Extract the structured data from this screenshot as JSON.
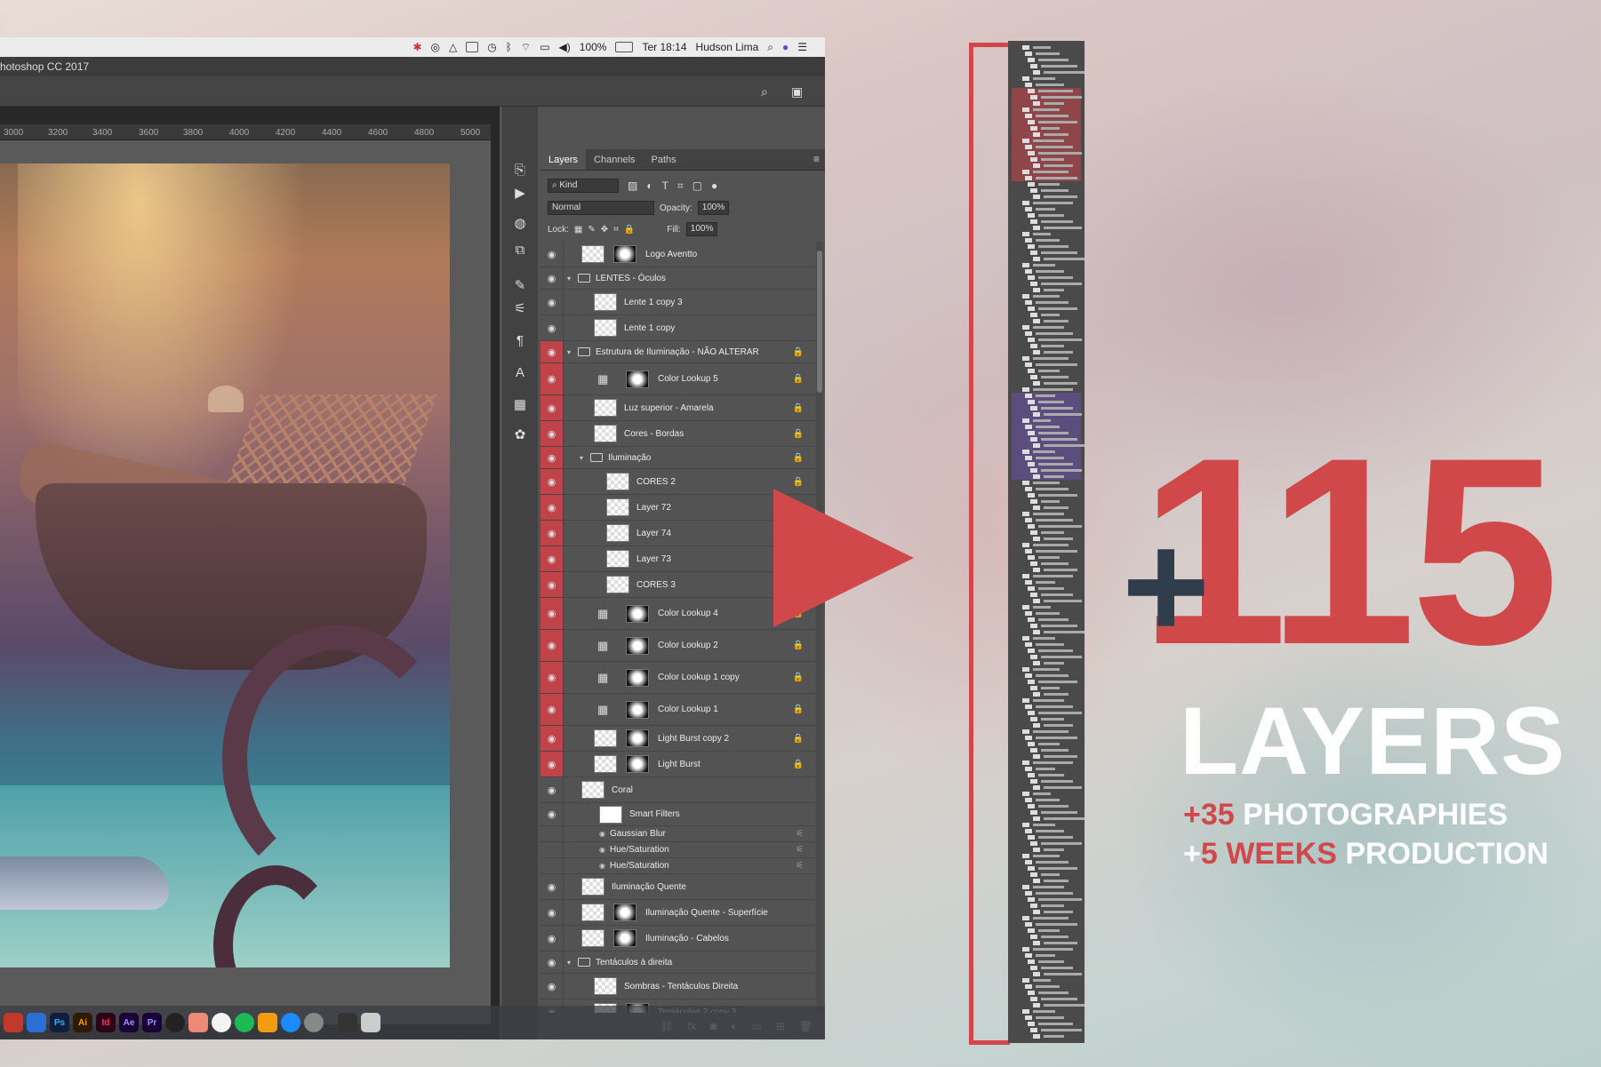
{
  "menubar": {
    "battery": "100%",
    "time": "Ter 18:14",
    "user": "Hudson Lima"
  },
  "app": {
    "title": "hotoshop CC 2017"
  },
  "ruler": {
    "ticks": [
      "3000",
      "3200",
      "3400",
      "3600",
      "3800",
      "4000",
      "4200",
      "4400",
      "4600",
      "4800",
      "5000"
    ]
  },
  "panel": {
    "tabs": [
      "Layers",
      "Channels",
      "Paths"
    ],
    "filter_kind": "Kind",
    "blend_mode": "Normal",
    "opacity_label": "Opacity:",
    "opacity_value": "100%",
    "lock_label": "Lock:",
    "fill_label": "Fill:",
    "fill_value": "100%"
  },
  "layers": [
    {
      "name": "Logo Aventto",
      "type": "thumbmask",
      "red": false,
      "indent": 0,
      "lock": false
    },
    {
      "name": "LENTES - Óculos",
      "type": "group",
      "red": false,
      "indent": 0,
      "lock": false
    },
    {
      "name": "Lente 1 copy 3",
      "type": "thumb",
      "red": false,
      "indent": 1,
      "lock": false
    },
    {
      "name": "Lente 1 copy",
      "type": "thumb",
      "red": false,
      "indent": 1,
      "lock": false
    },
    {
      "name": "Estrutura de Iluminação - NÃO ALTERAR",
      "type": "group",
      "red": true,
      "indent": 0,
      "lock": true
    },
    {
      "name": "Color Lookup 5",
      "type": "adjmask",
      "red": true,
      "indent": 1,
      "lock": true
    },
    {
      "name": "Luz superior - Amarela",
      "type": "thumb",
      "red": true,
      "indent": 1,
      "lock": true
    },
    {
      "name": "Cores - Bordas",
      "type": "thumb",
      "red": true,
      "indent": 1,
      "lock": true
    },
    {
      "name": "Iluminação",
      "type": "group",
      "red": true,
      "indent": 1,
      "lock": true
    },
    {
      "name": "CORES 2",
      "type": "thumb",
      "red": true,
      "indent": 2,
      "lock": true
    },
    {
      "name": "Layer 72",
      "type": "thumb",
      "red": true,
      "indent": 2,
      "lock": true
    },
    {
      "name": "Layer 74",
      "type": "thumb",
      "red": true,
      "indent": 2,
      "lock": true
    },
    {
      "name": "Layer 73",
      "type": "thumb",
      "red": true,
      "indent": 2,
      "lock": true
    },
    {
      "name": "CORES 3",
      "type": "thumb",
      "red": true,
      "indent": 2,
      "lock": true
    },
    {
      "name": "Color Lookup 4",
      "type": "adjmask",
      "red": true,
      "indent": 1,
      "lock": true
    },
    {
      "name": "Color Lookup 2",
      "type": "adjmask",
      "red": true,
      "indent": 1,
      "lock": true
    },
    {
      "name": "Color Lookup 1 copy",
      "type": "adjmask",
      "red": true,
      "indent": 1,
      "lock": true
    },
    {
      "name": "Color Lookup 1",
      "type": "adjmask",
      "red": true,
      "indent": 1,
      "lock": true
    },
    {
      "name": "Light Burst copy 2",
      "type": "thumbmask",
      "red": true,
      "indent": 1,
      "lock": true
    },
    {
      "name": "Light Burst",
      "type": "thumbmask",
      "red": true,
      "indent": 1,
      "lock": true
    },
    {
      "name": "Coral",
      "type": "thumb",
      "red": false,
      "indent": 0,
      "lock": false
    },
    {
      "name": "Smart Filters",
      "type": "smart",
      "red": false,
      "indent": 1,
      "lock": false
    },
    {
      "name": "Gaussian Blur",
      "type": "filter",
      "red": false,
      "indent": 2,
      "lock": false
    },
    {
      "name": "Hue/Saturation",
      "type": "filter",
      "red": false,
      "indent": 2,
      "lock": false
    },
    {
      "name": "Hue/Saturation",
      "type": "filter",
      "red": false,
      "indent": 2,
      "lock": false
    },
    {
      "name": "Iluminação Quente",
      "type": "thumb",
      "red": false,
      "indent": 0,
      "lock": false
    },
    {
      "name": "Iluminação Quente - Superfície",
      "type": "thumbmask",
      "red": false,
      "indent": 0,
      "lock": false
    },
    {
      "name": "Iluminação - Cabelos",
      "type": "thumbmask",
      "red": false,
      "indent": 0,
      "lock": false
    },
    {
      "name": "Tentáculos à direita",
      "type": "group",
      "red": false,
      "indent": 0,
      "lock": false
    },
    {
      "name": "Sombras - Tentáculos Direita",
      "type": "thumb",
      "red": false,
      "indent": 1,
      "lock": false
    },
    {
      "name": "Tentáculos 2 copy 3",
      "type": "thumbmask",
      "red": false,
      "indent": 1,
      "lock": false
    }
  ],
  "dock": {
    "apps": [
      {
        "label": "Ps",
        "bg": "#0d1f3d",
        "fg": "#31a8ff"
      },
      {
        "label": "Ai",
        "bg": "#2d1a00",
        "fg": "#ff9a00"
      },
      {
        "label": "Id",
        "bg": "#2d0017",
        "fg": "#ff3366"
      },
      {
        "label": "Ae",
        "bg": "#1a0036",
        "fg": "#9999ff"
      },
      {
        "label": "Pr",
        "bg": "#1a0036",
        "fg": "#9999ff"
      }
    ]
  },
  "stats": {
    "plus": "+",
    "layers_count": "115",
    "layers_word": "LAYERS",
    "photos_num": "+35",
    "photos_label": "PHOTOGRAPHIES",
    "weeks_prefix": "+",
    "weeks_num": "5 WEEKS",
    "weeks_label": "PRODUCTION"
  },
  "colors": {
    "accent_red": "#d0484a",
    "dark_plus": "#2f3d4c",
    "panel_bg": "#535353"
  }
}
